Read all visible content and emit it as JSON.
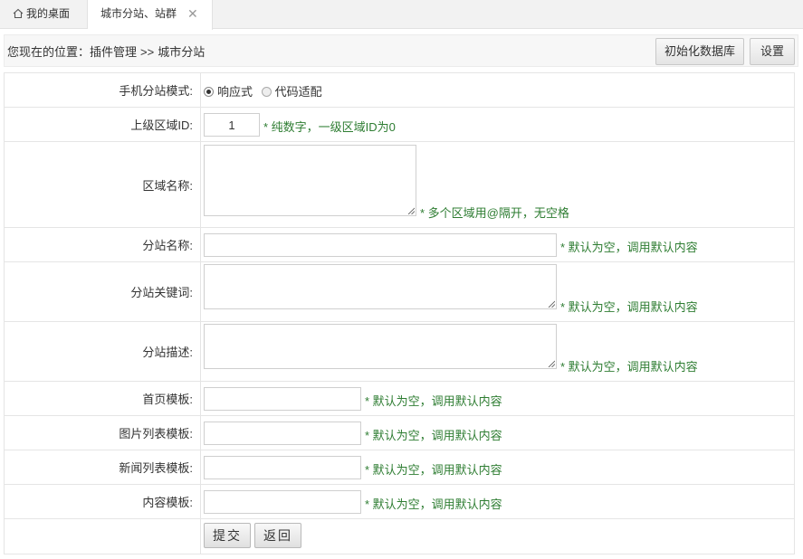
{
  "tabs": {
    "home_label": "我的桌面",
    "active_label": "城市分站、站群",
    "close_glyph": "✕"
  },
  "breadcrumb": {
    "prefix": "您现在的位置：",
    "path1": "插件管理",
    "sep": ">>",
    "path2": "城市分站"
  },
  "toolbar": {
    "init_db_label": "初始化数据库",
    "settings_label": "设置"
  },
  "form": {
    "mobile_mode": {
      "label": "手机分站模式:",
      "option1": "响应式",
      "option2": "代码适配",
      "selected": "响应式"
    },
    "parent_area": {
      "label": "上级区域ID:",
      "value": "1",
      "hint": "* 纯数字，一级区域ID为0"
    },
    "area_name": {
      "label": "区域名称:",
      "value": "",
      "hint": "* 多个区域用@隔开，无空格"
    },
    "site_name": {
      "label": "分站名称:",
      "value": "",
      "hint": "* 默认为空，调用默认内容"
    },
    "site_keywords": {
      "label": "分站关键词:",
      "value": "",
      "hint": "* 默认为空，调用默认内容"
    },
    "site_desc": {
      "label": "分站描述:",
      "value": "",
      "hint": "* 默认为空，调用默认内容"
    },
    "home_tpl": {
      "label": "首页模板:",
      "value": "",
      "hint": "* 默认为空，调用默认内容"
    },
    "pic_list_tpl": {
      "label": "图片列表模板:",
      "value": "",
      "hint": "* 默认为空，调用默认内容"
    },
    "news_list_tpl": {
      "label": "新闻列表模板:",
      "value": "",
      "hint": "* 默认为空，调用默认内容"
    },
    "content_tpl": {
      "label": "内容模板:",
      "value": "",
      "hint": "* 默认为空，调用默认内容"
    },
    "submit_label": "提交",
    "back_label": "返回"
  },
  "icons": {
    "home": "home-icon",
    "close": "close-icon",
    "resize": "resize-grip-icon"
  },
  "colors": {
    "hint_green": "#2e7d32",
    "border": "#e5e5e5"
  }
}
